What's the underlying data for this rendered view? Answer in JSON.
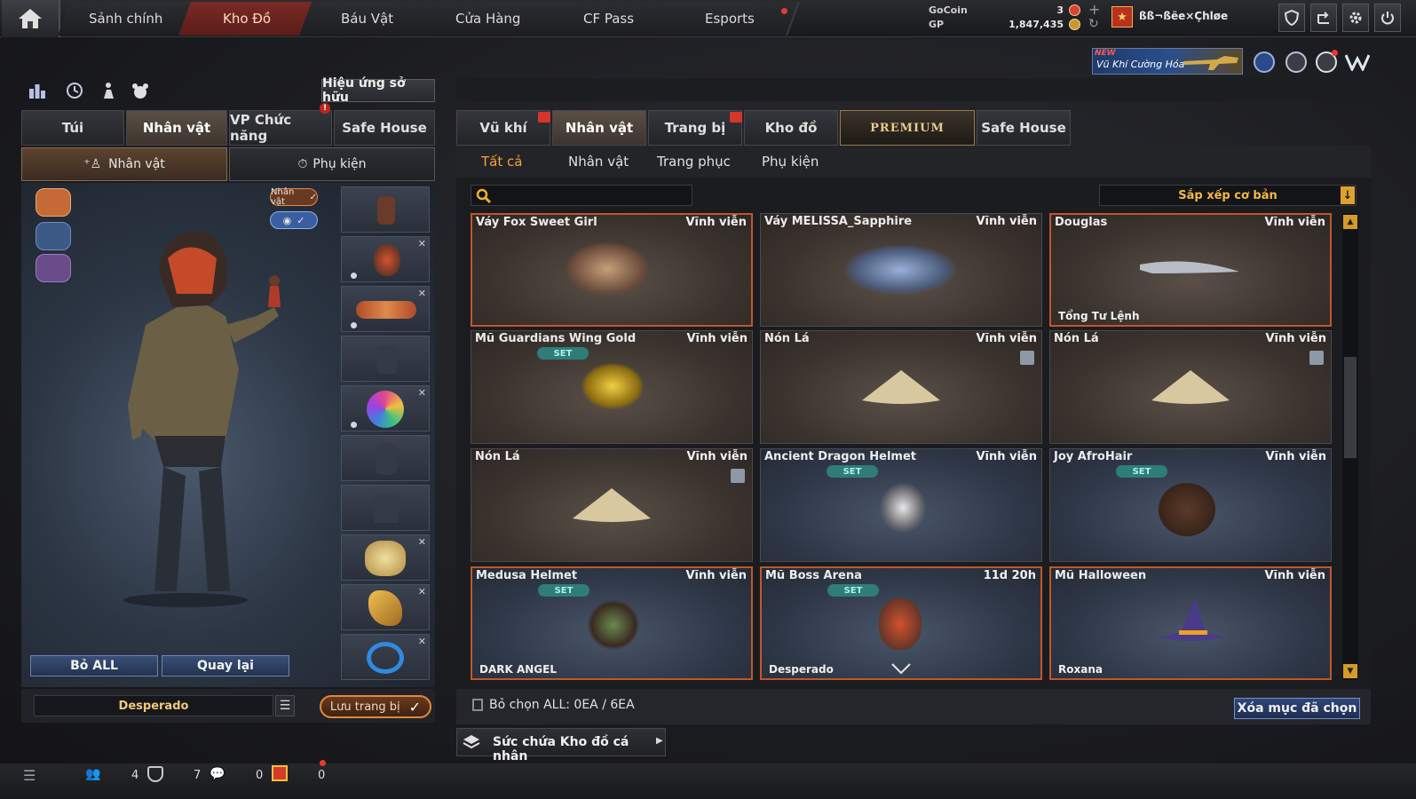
{
  "nav": {
    "tabs": [
      "Sảnh chính",
      "Kho Đồ",
      "Báu Vật",
      "Cửa Hàng",
      "CF Pass",
      "Esports"
    ],
    "active_index": 1
  },
  "currency": {
    "gocoin_label": "GoCoin",
    "gp_label": "GP",
    "gocoin_value": "3",
    "gp_value": "1,847,435",
    "plus": "+"
  },
  "user": {
    "name": "ßß¬ßëe×Çhløe"
  },
  "promo": {
    "new_tag": "NEW",
    "text": "Vũ Khí Cường Hóa"
  },
  "left": {
    "effects_button": "Hiệu ứng sở hữu",
    "tabs": [
      "Túi",
      "Nhân vật",
      "VP Chức năng",
      "Safe House"
    ],
    "active_tab": 1,
    "alert_mark": "!",
    "subtabs": [
      "Nhân vật",
      "Phụ kiện"
    ],
    "char_tag": "Nhân vật",
    "remove_all": "Bỏ ALL",
    "back": "Quay lại",
    "preset_name": "Desperado",
    "save_button": "Lưu trang bị",
    "slot_close": "✕"
  },
  "right": {
    "tabs": [
      "Vũ khí",
      "Nhân vật",
      "Trang bị",
      "Kho đồ",
      "PREMIUM",
      "Safe House"
    ],
    "active_tab": 1,
    "subtabs": [
      "Tất cả",
      "Nhân vật",
      "Trang phục",
      "Phụ kiện"
    ],
    "active_subtab": 0,
    "search_placeholder": "",
    "sort_label": "Sắp xếp cơ bản",
    "set_label": "SET",
    "items": [
      {
        "name": "Váy Fox Sweet Girl",
        "duration": "Vĩnh viễn",
        "sub": "",
        "set": false,
        "trash": false,
        "theme": "brown",
        "selected": true
      },
      {
        "name": "Váy MELISSA_Sapphire",
        "duration": "Vĩnh viễn",
        "sub": "",
        "set": false,
        "trash": false,
        "theme": "brown",
        "selected": false
      },
      {
        "name": "Douglas",
        "duration": "Vĩnh viễn",
        "sub": "Tổng Tư Lệnh",
        "set": false,
        "trash": false,
        "theme": "brown",
        "selected": true
      },
      {
        "name": "Mũ Guardians Wing Gold",
        "duration": "Vĩnh viễn",
        "sub": "",
        "set": true,
        "trash": false,
        "theme": "brown",
        "selected": false
      },
      {
        "name": "Nón Lá",
        "duration": "Vĩnh viễn",
        "sub": "",
        "set": false,
        "trash": true,
        "theme": "brown",
        "selected": false
      },
      {
        "name": "Nón Lá",
        "duration": "Vĩnh viễn",
        "sub": "",
        "set": false,
        "trash": true,
        "theme": "brown",
        "selected": false
      },
      {
        "name": "Nón Lá",
        "duration": "Vĩnh viễn",
        "sub": "",
        "set": false,
        "trash": true,
        "theme": "brown",
        "selected": false
      },
      {
        "name": "Ancient Dragon Helmet",
        "duration": "Vĩnh viễn",
        "sub": "",
        "set": true,
        "trash": false,
        "theme": "blue",
        "selected": false
      },
      {
        "name": "Joy AfroHair",
        "duration": "Vĩnh viễn",
        "sub": "",
        "set": true,
        "trash": false,
        "theme": "blue",
        "selected": false
      },
      {
        "name": "Medusa Helmet",
        "duration": "Vĩnh viễn",
        "sub": "DARK ANGEL",
        "set": true,
        "trash": false,
        "theme": "blue",
        "selected": true
      },
      {
        "name": "Mũ Boss Arena",
        "duration": "11d 20h",
        "sub": "Desperado",
        "set": true,
        "trash": false,
        "theme": "blue",
        "selected": true
      },
      {
        "name": "Mũ Halloween",
        "duration": "Vĩnh viễn",
        "sub": "Roxana",
        "set": false,
        "trash": false,
        "theme": "blue",
        "selected": true
      }
    ],
    "selection_status": "Bỏ chọn ALL: 0EA / 6EA",
    "delete_button": "Xóa mục đã chọn",
    "capacity_label": "Sức chứa Kho đồ cá nhân"
  },
  "bottom": {
    "counts": [
      "4",
      "7",
      "0",
      "0"
    ]
  },
  "colors": {
    "accent_orange": "#f4a33a",
    "active_nav": "#7b2a24",
    "set_badge": "#2f7d78",
    "selected_border": "#c0572c"
  }
}
